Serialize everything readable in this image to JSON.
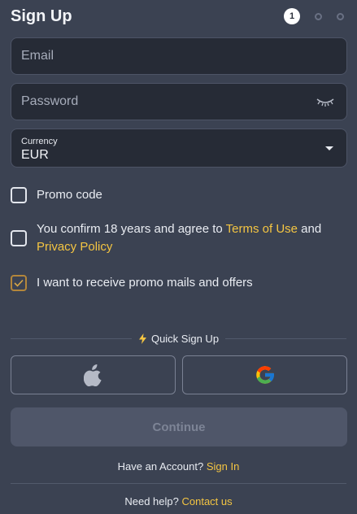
{
  "header": {
    "title": "Sign Up",
    "step_current": "1"
  },
  "form": {
    "email_placeholder": "Email",
    "password_placeholder": "Password",
    "currency_label": "Currency",
    "currency_value": "EUR"
  },
  "checks": {
    "promo_label": "Promo code",
    "promo_checked": false,
    "terms_prefix": "You confirm 18 years and agree to ",
    "terms_link": "Terms of Use",
    "terms_and": " and",
    "privacy_link": "Privacy Policy",
    "terms_checked": false,
    "mails_label": "I want to receive promo mails and offers",
    "mails_checked": true
  },
  "quick": {
    "label": "Quick Sign Up",
    "icon": "lightning-icon"
  },
  "social": {
    "apple_icon": "apple-icon",
    "google_icon": "google-icon"
  },
  "continue_label": "Continue",
  "footer": {
    "account_text": "Have an Account?",
    "signin_link": "Sign In",
    "help_text": "Need help?",
    "contact_link": "Contact us"
  },
  "colors": {
    "background": "#3b4252",
    "field_bg": "#262b36",
    "accent_link": "#f4c542",
    "checkbox_checked": "#b3863b"
  }
}
